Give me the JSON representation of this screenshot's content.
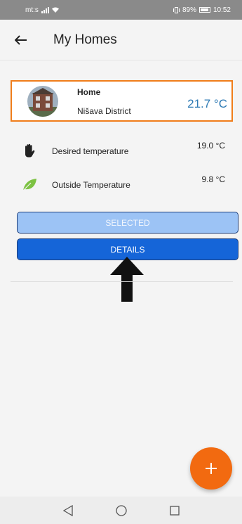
{
  "status_bar": {
    "carrier": "mt:s",
    "battery": "89%",
    "time": "10:52"
  },
  "header": {
    "title": "My Homes"
  },
  "home": {
    "name": "Home",
    "district": "Nišava District",
    "temperature": "21.7 °C"
  },
  "desired": {
    "label": "Desired temperature",
    "value": "19.0 °C"
  },
  "outside": {
    "label": "Outside Temperature",
    "value": "9.8 °C"
  },
  "buttons": {
    "selected": "SELECTED",
    "details": "DETAILS"
  },
  "fab": {
    "label": "+"
  },
  "colors": {
    "accent_orange": "#f07d1a",
    "primary_blue": "#1565d8",
    "temp_blue": "#2f7bb5"
  }
}
